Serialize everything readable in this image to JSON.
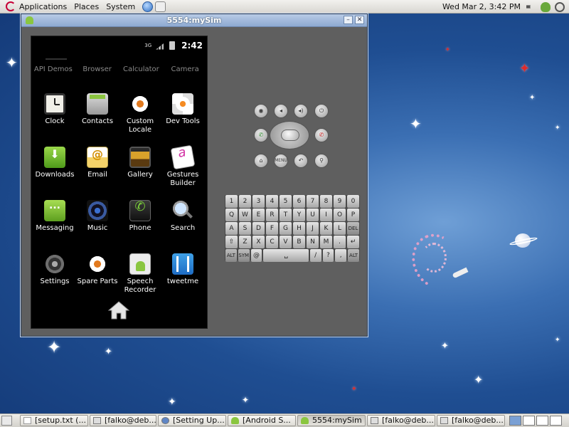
{
  "top_panel": {
    "menus": [
      "Applications",
      "Places",
      "System"
    ],
    "clock": "Wed Mar  2,  3:42 PM"
  },
  "window": {
    "title": "5554:mySim"
  },
  "phone": {
    "status": {
      "network": "3G",
      "time": "2:42"
    },
    "top_row": [
      "API Demos",
      "Browser",
      "Calculator",
      "Camera"
    ],
    "apps": [
      {
        "label": "Clock"
      },
      {
        "label": "Contacts"
      },
      {
        "label": "Custom\nLocale"
      },
      {
        "label": "Dev Tools"
      },
      {
        "label": "Downloads"
      },
      {
        "label": "Email"
      },
      {
        "label": "Gallery"
      },
      {
        "label": "Gestures\nBuilder"
      },
      {
        "label": "Messaging"
      },
      {
        "label": "Music"
      },
      {
        "label": "Phone"
      },
      {
        "label": "Search"
      },
      {
        "label": "Settings"
      },
      {
        "label": "Spare Parts"
      },
      {
        "label": "Speech\nRecorder"
      },
      {
        "label": "tweetme"
      }
    ]
  },
  "controls": {
    "menu_label": "MENU"
  },
  "keyboard": {
    "row1": [
      "1",
      "2",
      "3",
      "4",
      "5",
      "6",
      "7",
      "8",
      "9",
      "0"
    ],
    "row2": [
      "Q",
      "W",
      "E",
      "R",
      "T",
      "Y",
      "U",
      "I",
      "O",
      "P"
    ],
    "row3": [
      "A",
      "S",
      "D",
      "F",
      "G",
      "H",
      "J",
      "K",
      "L",
      "DEL"
    ],
    "row4": [
      "⇧",
      "Z",
      "X",
      "C",
      "V",
      "B",
      "N",
      "M",
      ".",
      "↵"
    ],
    "row5": [
      "ALT",
      "SYM",
      "@",
      "␣",
      "/",
      "?",
      ",",
      "ALT"
    ]
  },
  "taskbar": {
    "tasks": [
      "[setup.txt (...",
      "[falko@deb...",
      "[Setting Up...",
      "[Android S...",
      "5554:mySim",
      "[falko@deb...",
      "[falko@deb..."
    ]
  },
  "colors": {
    "desktop": "#1f4e92",
    "titlebar": "#8eaad2",
    "android_green": "#8ac640"
  }
}
